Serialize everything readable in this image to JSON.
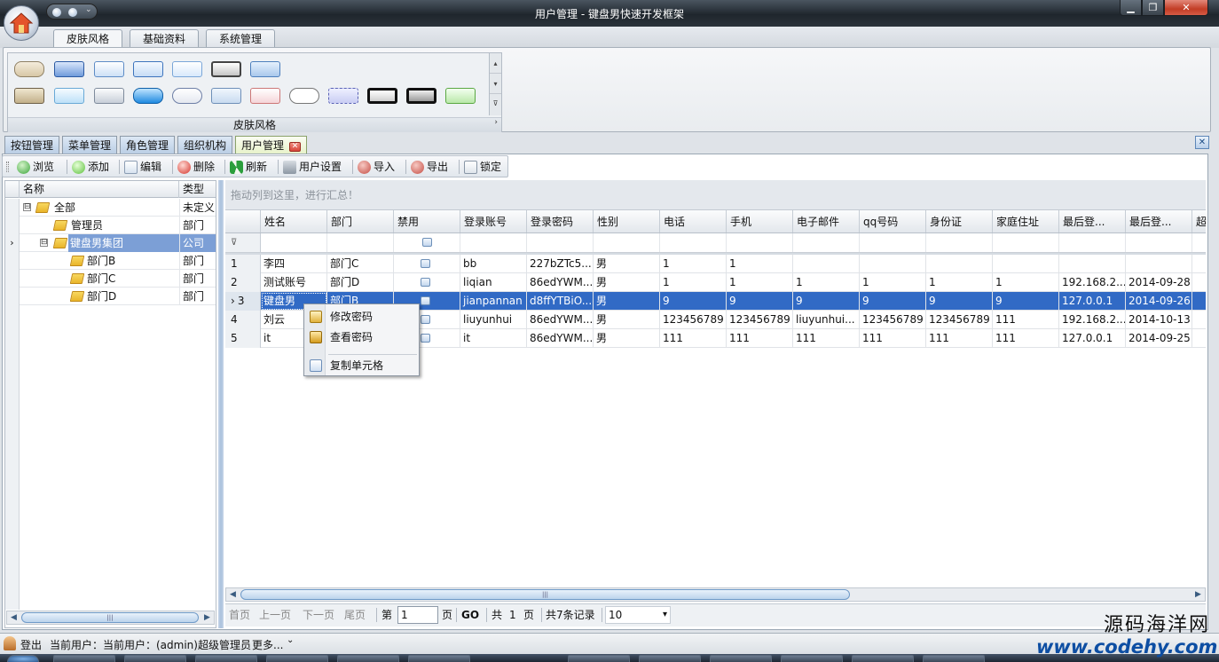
{
  "window": {
    "title": "用户管理 - 键盘男快速开发框架",
    "controls": {
      "minimize": "▁",
      "maximize": "❐",
      "close": "✕"
    }
  },
  "ribbon": {
    "tabs": [
      "皮肤风格",
      "基础资料",
      "系统管理"
    ],
    "active_tab": "皮肤风格",
    "group_label": "皮肤风格",
    "gallery_up": "▴",
    "gallery_down": "▾",
    "gallery_more": "⊽",
    "launcher": "›"
  },
  "doc_tabs": {
    "items": [
      "按钮管理",
      "菜单管理",
      "角色管理",
      "组织机构",
      "用户管理"
    ],
    "active": "用户管理",
    "close_glyph": "✕",
    "panel_close": "✕"
  },
  "toolbar": {
    "buttons": [
      "浏览",
      "添加",
      "编辑",
      "删除",
      "刷新",
      "用户设置",
      "导入",
      "导出",
      "锁定"
    ]
  },
  "tree": {
    "columns": [
      "名称",
      "类型"
    ],
    "rows": [
      {
        "name": "全部",
        "type": "未定义",
        "expander": "⊟"
      },
      {
        "name": "管理员",
        "type": "部门"
      },
      {
        "name": "键盘男集团",
        "type": "公司",
        "expander": "⊟",
        "current": true
      },
      {
        "name": "部门B",
        "type": "部门"
      },
      {
        "name": "部门C",
        "type": "部门"
      },
      {
        "name": "部门D",
        "type": "部门"
      }
    ],
    "current_marker": "›",
    "scroll_left": "◀",
    "scroll_right": "▶",
    "scroll_grip": "|||"
  },
  "grid": {
    "group_panel_text": "拖动列到这里，进行汇总！",
    "columns": [
      "姓名",
      "部门",
      "禁用",
      "登录账号",
      "登录密码",
      "性别",
      "电话",
      "手机",
      "电子邮件",
      "qq号码",
      "身份证",
      "家庭住址",
      "最后登...",
      "最后登...",
      "超"
    ],
    "filter_icon": "⊽",
    "rows": [
      {
        "num": "1",
        "name": "李四",
        "dept": "部门C",
        "account": "bb",
        "password": "227bZTc5...",
        "sex": "男",
        "phone": "1",
        "mobile": "1",
        "email": "",
        "qq": "",
        "idcard": "",
        "address": "",
        "last_ip": "",
        "last_date": ""
      },
      {
        "num": "2",
        "name": "测试账号",
        "dept": "部门D",
        "account": "liqian",
        "password": "86edYWM...",
        "sex": "男",
        "phone": "1",
        "mobile": "1",
        "email": "1",
        "qq": "1",
        "idcard": "1",
        "address": "1",
        "last_ip": "192.168.2...",
        "last_date": "2014-09-28"
      },
      {
        "num": "3",
        "name": "键盘男",
        "dept": "部门B",
        "account": "jianpannan",
        "password": "d8ffYTBiO...",
        "sex": "男",
        "phone": "9",
        "mobile": "9",
        "email": "9",
        "qq": "9",
        "idcard": "9",
        "address": "9",
        "last_ip": "127.0.0.1",
        "last_date": "2014-09-26",
        "selected": true
      },
      {
        "num": "4",
        "name": "刘云",
        "dept": "",
        "account": "liuyunhui",
        "password": "86edYWM...",
        "sex": "男",
        "phone": "123456789",
        "mobile": "123456789",
        "email": "liuyunhui...",
        "qq": "123456789",
        "idcard": "123456789",
        "address": "111",
        "last_ip": "192.168.2...",
        "last_date": "2014-10-13"
      },
      {
        "num": "5",
        "name": "it",
        "dept": "",
        "account": "it",
        "password": "86edYWM...",
        "sex": "男",
        "phone": "111",
        "mobile": "111",
        "email": "111",
        "qq": "111",
        "idcard": "111",
        "address": "111",
        "last_ip": "127.0.0.1",
        "last_date": "2014-09-25"
      }
    ],
    "current_marker": "›",
    "scroll_left": "◀",
    "scroll_right": "▶",
    "scroll_grip": "|||"
  },
  "context_menu": {
    "items": [
      "修改密码",
      "查看密码",
      "复制单元格"
    ]
  },
  "pager": {
    "first": "首页",
    "prev": "上一页",
    "next": "下一页",
    "last": "尾页",
    "page_prefix": "第",
    "page_value": "1",
    "page_suffix": "页",
    "go": "GO",
    "total_pages_prefix": "共",
    "total_pages": "1",
    "total_pages_suffix": "页",
    "total_records": "共7条记录",
    "page_size": "10",
    "dropdown": "▾"
  },
  "status_bar": {
    "logout": "登出",
    "current_user": "当前用户：当前用户：(admin)超级管理员",
    "more": "更多...",
    "more_arrow": "⌄"
  },
  "watermark": {
    "line1": "源码海洋网",
    "line2": "www.codehy.com"
  },
  "colors": {
    "selection": "#316ac5",
    "active_tab": "#e6f2c8",
    "title_bar": "#1f262d"
  }
}
